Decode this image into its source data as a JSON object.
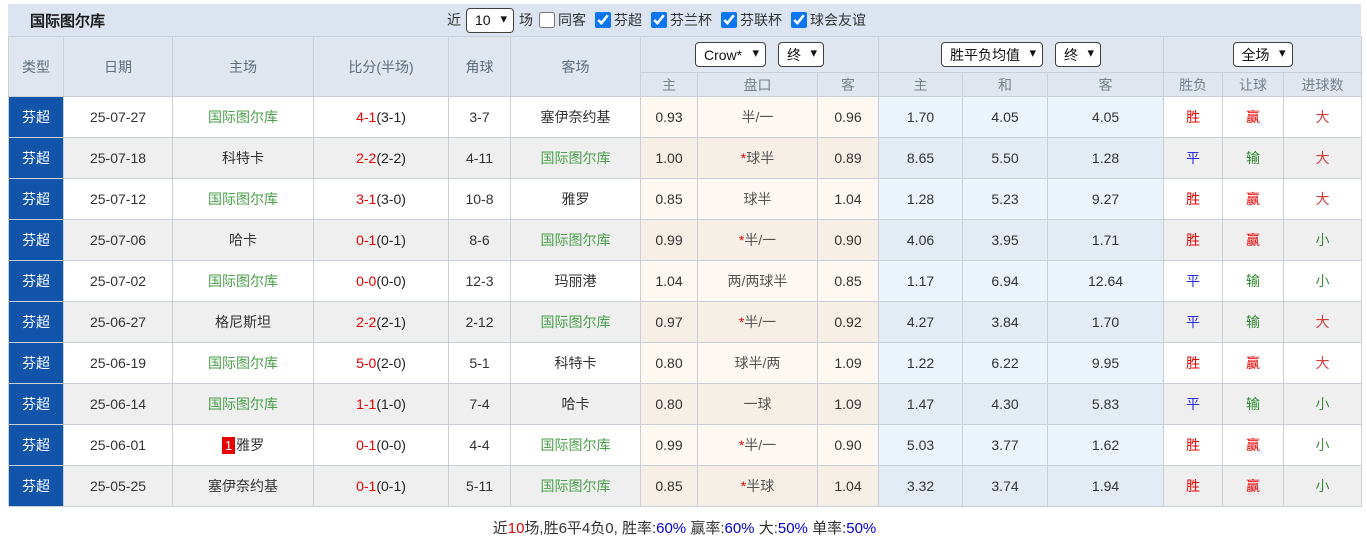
{
  "toolbar": {
    "team_title": "国际图尔库",
    "recent_label": "近",
    "recent_count": "10",
    "matches_label": "场",
    "same_venue_label": "同客",
    "competitions": [
      {
        "label": "芬超",
        "checked": true
      },
      {
        "label": "芬兰杯",
        "checked": true
      },
      {
        "label": "芬联杯",
        "checked": true
      },
      {
        "label": "球会友谊",
        "checked": true
      }
    ]
  },
  "table": {
    "left_headers": [
      "类型",
      "日期",
      "主场",
      "比分(半场)",
      "角球",
      "客场"
    ],
    "odds_group": {
      "company": "Crow*",
      "time": "终",
      "sub": [
        "主",
        "盘口",
        "客"
      ]
    },
    "avg_group": {
      "select": "胜平负均值",
      "time": "终",
      "sub": [
        "主",
        "和",
        "客"
      ]
    },
    "result_group": {
      "select": "全场",
      "sub": [
        "胜负",
        "让球",
        "进球数"
      ]
    },
    "rows": [
      {
        "type": "芬超",
        "date": "25-07-27",
        "home": "国际图尔库",
        "home_badge": "",
        "home_focus": true,
        "score": "4-1",
        "half": "(3-1)",
        "corner": "3-7",
        "away": "塞伊奈约基",
        "away_focus": false,
        "crow_home": "0.93",
        "handicap_star": "",
        "handicap": "半/一",
        "crow_away": "0.96",
        "avg_home": "1.70",
        "avg_draw": "4.05",
        "avg_away": "4.05",
        "result": "胜",
        "handicap_result": "赢",
        "goals_result": "大"
      },
      {
        "type": "芬超",
        "date": "25-07-18",
        "home": "科特卡",
        "home_badge": "",
        "home_focus": false,
        "score": "2-2",
        "half": "(2-2)",
        "corner": "4-11",
        "away": "国际图尔库",
        "away_focus": true,
        "crow_home": "1.00",
        "handicap_star": "*",
        "handicap": "球半",
        "crow_away": "0.89",
        "avg_home": "8.65",
        "avg_draw": "5.50",
        "avg_away": "1.28",
        "result": "平",
        "handicap_result": "输",
        "goals_result": "大"
      },
      {
        "type": "芬超",
        "date": "25-07-12",
        "home": "国际图尔库",
        "home_badge": "",
        "home_focus": true,
        "score": "3-1",
        "half": "(3-0)",
        "corner": "10-8",
        "away": "雅罗",
        "away_focus": false,
        "crow_home": "0.85",
        "handicap_star": "",
        "handicap": "球半",
        "crow_away": "1.04",
        "avg_home": "1.28",
        "avg_draw": "5.23",
        "avg_away": "9.27",
        "result": "胜",
        "handicap_result": "赢",
        "goals_result": "大"
      },
      {
        "type": "芬超",
        "date": "25-07-06",
        "home": "哈卡",
        "home_badge": "",
        "home_focus": false,
        "score": "0-1",
        "half": "(0-1)",
        "corner": "8-6",
        "away": "国际图尔库",
        "away_focus": true,
        "crow_home": "0.99",
        "handicap_star": "*",
        "handicap": "半/一",
        "crow_away": "0.90",
        "avg_home": "4.06",
        "avg_draw": "3.95",
        "avg_away": "1.71",
        "result": "胜",
        "handicap_result": "赢",
        "goals_result": "小"
      },
      {
        "type": "芬超",
        "date": "25-07-02",
        "home": "国际图尔库",
        "home_badge": "",
        "home_focus": true,
        "score": "0-0",
        "half": "(0-0)",
        "corner": "12-3",
        "away": "玛丽港",
        "away_focus": false,
        "crow_home": "1.04",
        "handicap_star": "",
        "handicap": "两/两球半",
        "crow_away": "0.85",
        "avg_home": "1.17",
        "avg_draw": "6.94",
        "avg_away": "12.64",
        "result": "平",
        "handicap_result": "输",
        "goals_result": "小"
      },
      {
        "type": "芬超",
        "date": "25-06-27",
        "home": "格尼斯坦",
        "home_badge": "",
        "home_focus": false,
        "score": "2-2",
        "half": "(2-1)",
        "corner": "2-12",
        "away": "国际图尔库",
        "away_focus": true,
        "crow_home": "0.97",
        "handicap_star": "*",
        "handicap": "半/一",
        "crow_away": "0.92",
        "avg_home": "4.27",
        "avg_draw": "3.84",
        "avg_away": "1.70",
        "result": "平",
        "handicap_result": "输",
        "goals_result": "大"
      },
      {
        "type": "芬超",
        "date": "25-06-19",
        "home": "国际图尔库",
        "home_badge": "",
        "home_focus": true,
        "score": "5-0",
        "half": "(2-0)",
        "corner": "5-1",
        "away": "科特卡",
        "away_focus": false,
        "crow_home": "0.80",
        "handicap_star": "",
        "handicap": "球半/两",
        "crow_away": "1.09",
        "avg_home": "1.22",
        "avg_draw": "6.22",
        "avg_away": "9.95",
        "result": "胜",
        "handicap_result": "赢",
        "goals_result": "大"
      },
      {
        "type": "芬超",
        "date": "25-06-14",
        "home": "国际图尔库",
        "home_badge": "",
        "home_focus": true,
        "score": "1-1",
        "half": "(1-0)",
        "corner": "7-4",
        "away": "哈卡",
        "away_focus": false,
        "crow_home": "0.80",
        "handicap_star": "",
        "handicap": "一球",
        "crow_away": "1.09",
        "avg_home": "1.47",
        "avg_draw": "4.30",
        "avg_away": "5.83",
        "result": "平",
        "handicap_result": "输",
        "goals_result": "小"
      },
      {
        "type": "芬超",
        "date": "25-06-01",
        "home": "雅罗",
        "home_badge": "1",
        "home_focus": false,
        "score": "0-1",
        "half": "(0-0)",
        "corner": "4-4",
        "away": "国际图尔库",
        "away_focus": true,
        "crow_home": "0.99",
        "handicap_star": "*",
        "handicap": "半/一",
        "crow_away": "0.90",
        "avg_home": "5.03",
        "avg_draw": "3.77",
        "avg_away": "1.62",
        "result": "胜",
        "handicap_result": "赢",
        "goals_result": "小"
      },
      {
        "type": "芬超",
        "date": "25-05-25",
        "home": "塞伊奈约基",
        "home_badge": "",
        "home_focus": false,
        "score": "0-1",
        "half": "(0-1)",
        "corner": "5-11",
        "away": "国际图尔库",
        "away_focus": true,
        "crow_home": "0.85",
        "handicap_star": "*",
        "handicap": "半球",
        "crow_away": "1.04",
        "avg_home": "3.32",
        "avg_draw": "3.74",
        "avg_away": "1.94",
        "result": "胜",
        "handicap_result": "赢",
        "goals_result": "小"
      }
    ]
  },
  "footer": {
    "prefix": "近",
    "count": "10",
    "record": "场,胜6平4负0, ",
    "win_rate_label": "胜率:",
    "win_rate": "60%",
    "handicap_rate_label": " 赢率:",
    "handicap_rate": "60%",
    "big_rate_label": " 大:",
    "big_rate": "50%",
    "odd_rate_label": " 单率:",
    "odd_rate": "50%"
  },
  "colors": {
    "type_badge_blue": "#1254a9",
    "focus_team_green": "#4aa04a",
    "win_red": "#e60000",
    "draw_blue": "#2b2bdd",
    "lose_green": "#2e8b2e",
    "value_blue": "#0000d6",
    "toolbar_bg": "#dbe4f0",
    "header_bg": "#dfe6ef"
  }
}
